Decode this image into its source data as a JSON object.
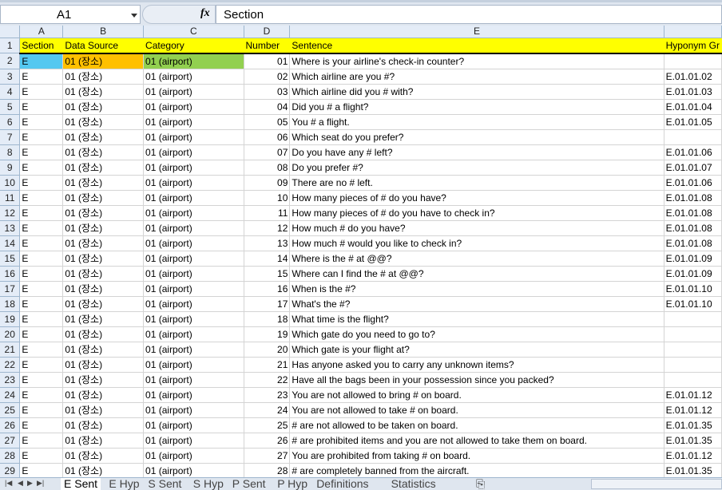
{
  "formula_bar": {
    "name_box": "A1",
    "fx_label": "fx",
    "formula": "Section"
  },
  "columns": [
    "A",
    "B",
    "C",
    "D",
    "E",
    ""
  ],
  "header": [
    "Section",
    "Data Source",
    "Category",
    "Number",
    "Sentence",
    "Hyponym Gr"
  ],
  "rows": [
    [
      "E",
      "01 (장소)",
      "01 (airport)",
      "01",
      "Where is your airline's check-in counter?",
      ""
    ],
    [
      "E",
      "01 (장소)",
      "01 (airport)",
      "02",
      "Which airline are you #?",
      "E.01.01.02"
    ],
    [
      "E",
      "01 (장소)",
      "01 (airport)",
      "03",
      "Which airline did you # with?",
      "E.01.01.03"
    ],
    [
      "E",
      "01 (장소)",
      "01 (airport)",
      "04",
      "Did you # a flight?",
      "E.01.01.04"
    ],
    [
      "E",
      "01 (장소)",
      "01 (airport)",
      "05",
      "You # a flight.",
      "E.01.01.05"
    ],
    [
      "E",
      "01 (장소)",
      "01 (airport)",
      "06",
      "Which seat do you prefer?",
      ""
    ],
    [
      "E",
      "01 (장소)",
      "01 (airport)",
      "07",
      "Do you have any # left?",
      "E.01.01.06"
    ],
    [
      "E",
      "01 (장소)",
      "01 (airport)",
      "08",
      "Do you prefer #?",
      "E.01.01.07"
    ],
    [
      "E",
      "01 (장소)",
      "01 (airport)",
      "09",
      "There are no # left.",
      "E.01.01.06"
    ],
    [
      "E",
      "01 (장소)",
      "01 (airport)",
      "10",
      "How many pieces of # do you have?",
      "E.01.01.08"
    ],
    [
      "E",
      "01 (장소)",
      "01 (airport)",
      "11",
      "How many pieces of # do you have to check in?",
      "E.01.01.08"
    ],
    [
      "E",
      "01 (장소)",
      "01 (airport)",
      "12",
      "How much # do you have?",
      "E.01.01.08"
    ],
    [
      "E",
      "01 (장소)",
      "01 (airport)",
      "13",
      "How much # would you like to check in?",
      "E.01.01.08"
    ],
    [
      "E",
      "01 (장소)",
      "01 (airport)",
      "14",
      "Where is the # at @@?",
      "E.01.01.09"
    ],
    [
      "E",
      "01 (장소)",
      "01 (airport)",
      "15",
      "Where can I find the # at @@?",
      "E.01.01.09"
    ],
    [
      "E",
      "01 (장소)",
      "01 (airport)",
      "16",
      "When is the #?",
      "E.01.01.10"
    ],
    [
      "E",
      "01 (장소)",
      "01 (airport)",
      "17",
      "What's the #?",
      "E.01.01.10"
    ],
    [
      "E",
      "01 (장소)",
      "01 (airport)",
      "18",
      "What time is the flight?",
      ""
    ],
    [
      "E",
      "01 (장소)",
      "01 (airport)",
      "19",
      "Which gate do you need to go to?",
      ""
    ],
    [
      "E",
      "01 (장소)",
      "01 (airport)",
      "20",
      "Which gate is your flight at?",
      ""
    ],
    [
      "E",
      "01 (장소)",
      "01 (airport)",
      "21",
      "Has anyone asked you to carry any unknown items?",
      ""
    ],
    [
      "E",
      "01 (장소)",
      "01 (airport)",
      "22",
      "Have all the bags been in your possession since you packed?",
      ""
    ],
    [
      "E",
      "01 (장소)",
      "01 (airport)",
      "23",
      "You are not allowed to bring # on board.",
      "E.01.01.12"
    ],
    [
      "E",
      "01 (장소)",
      "01 (airport)",
      "24",
      "You are not allowed to take # on board.",
      "E.01.01.12"
    ],
    [
      "E",
      "01 (장소)",
      "01 (airport)",
      "25",
      "# are not allowed to be taken on board.",
      "E.01.01.35"
    ],
    [
      "E",
      "01 (장소)",
      "01 (airport)",
      "26",
      "# are prohibited items and you are not allowed to take them on board.",
      "E.01.01.35"
    ],
    [
      "E",
      "01 (장소)",
      "01 (airport)",
      "27",
      "You are prohibited from taking # on board.",
      "E.01.01.12"
    ],
    [
      "E",
      "01 (장소)",
      "01 (airport)",
      "28",
      "# are completely banned from the aircraft.",
      "E.01.01.35"
    ]
  ],
  "row2_fills": [
    "#55c8f0",
    "#ffc000",
    "#92d050"
  ],
  "sheet_tabs": [
    "E Sent",
    "E Hyp",
    "S Sent",
    "S Hyp",
    "P Sent",
    "P Hyp",
    "Definitions",
    "Statistics"
  ],
  "active_tab": "E Sent"
}
